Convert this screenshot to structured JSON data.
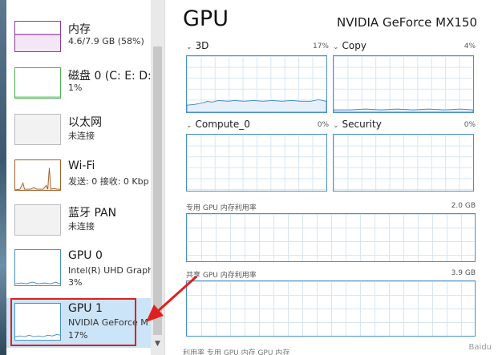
{
  "sidebar": {
    "items": [
      {
        "title": "内存",
        "sub1": "4.6/7.9 GB (58%)",
        "sub2": ""
      },
      {
        "title": "磁盘 0 (C: E: D:",
        "sub1": "1%",
        "sub2": ""
      },
      {
        "title": "以太网",
        "sub1": "未连接",
        "sub2": ""
      },
      {
        "title": "Wi-Fi",
        "sub1": "发送: 0  接收: 0 Kbp",
        "sub2": ""
      },
      {
        "title": "蓝牙 PAN",
        "sub1": "未连接",
        "sub2": ""
      },
      {
        "title": "GPU 0",
        "sub1": "Intel(R) UHD Graph",
        "sub2": "3%"
      },
      {
        "title": "GPU 1",
        "sub1": "NVIDIA GeForce M",
        "sub2": "17%"
      }
    ],
    "selected_index": 6
  },
  "main": {
    "title": "GPU",
    "model": "NVIDIA GeForce MX150",
    "engines": [
      {
        "label": "3D",
        "pct": "17%"
      },
      {
        "label": "Copy",
        "pct": "4%"
      },
      {
        "label": "Compute_0",
        "pct": "0%"
      },
      {
        "label": "Security",
        "pct": "0%"
      }
    ],
    "dedicated": {
      "label": "专用 GPU 内存利用率",
      "max": "2.0 GB"
    },
    "shared": {
      "label": "共享 GPU 内存利用率",
      "max": "3.9 GB"
    },
    "bottom_text": "利用率                  专用 GPU 内存            GPU 内存"
  },
  "colors": {
    "accent": "#4a90c6",
    "selection": "#cce4f7",
    "annotation": "#e02020",
    "memory": "#8b3c9e",
    "disk": "#4caf50",
    "wifi": "#a0622d"
  },
  "watermark": "Baidu"
}
